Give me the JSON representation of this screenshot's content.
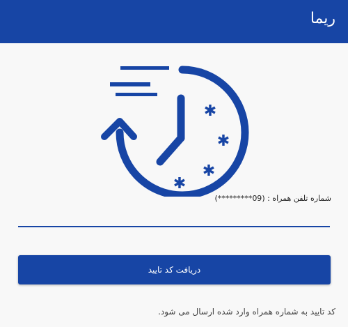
{
  "app_bar": {
    "title": "ریما",
    "color": "#1745a5"
  },
  "logo": {
    "icon": "clock-history-icon"
  },
  "phone": {
    "label": "شماره تلفن همراه : (09*********)",
    "value": ""
  },
  "submit_button": {
    "label": "دریافت کد تایید"
  },
  "hint": {
    "text": "کد تایید به شماره همراه وارد شده ارسال می شود."
  }
}
